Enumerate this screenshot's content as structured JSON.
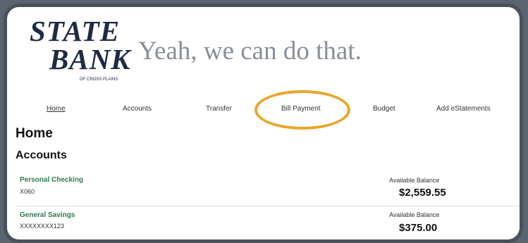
{
  "brand": {
    "line1": "STATE",
    "line2": "BANK",
    "subline": "OF CROSS PLAINS",
    "tagline": "Yeah, we can do that."
  },
  "nav": [
    "Home",
    "Accounts",
    "Transfer",
    "Bill Payment",
    "Budget",
    "Add eStatements"
  ],
  "page_title": "Home",
  "section_title": "Accounts",
  "accounts": [
    {
      "name": "Personal Checking",
      "number": "X060",
      "balance_label": "Available Balance",
      "balance": "$2,559.55"
    },
    {
      "name": "General Savings",
      "number": "XXXXXXXX123",
      "balance_label": "Available Balance",
      "balance": "$375.00"
    }
  ],
  "colors": {
    "highlight": "#e8a62a",
    "account_link": "#2d7a4f",
    "brand": "#1f2a44"
  }
}
